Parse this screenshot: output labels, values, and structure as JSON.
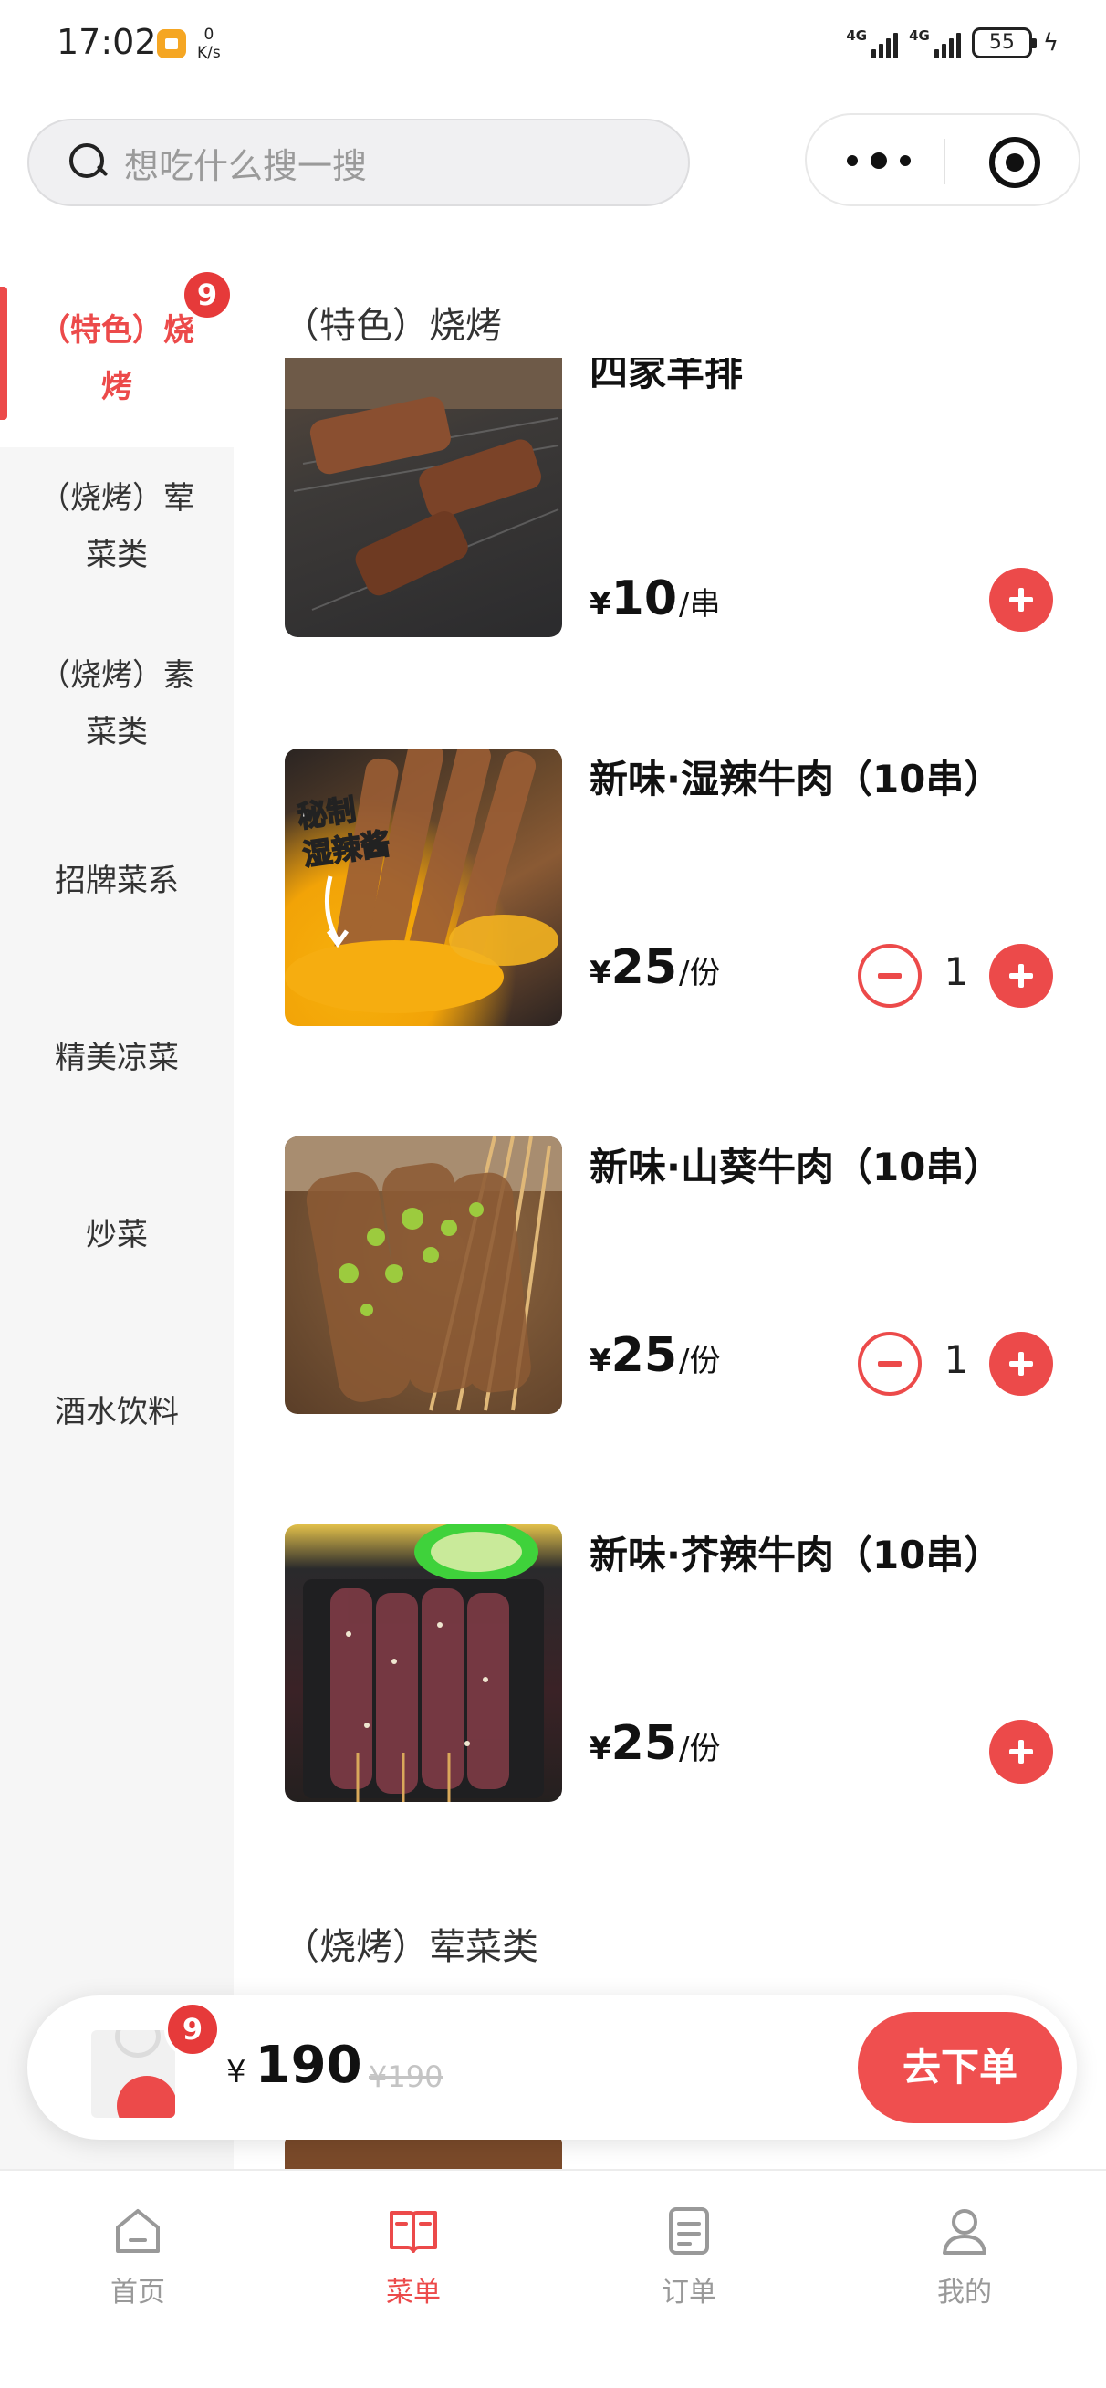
{
  "status": {
    "time": "17:02",
    "speed_value": "0",
    "speed_unit": "K/s",
    "net1": "4G",
    "net2": "4G",
    "battery": "55"
  },
  "search": {
    "placeholder": "想吃什么搜一搜"
  },
  "sidebar": {
    "items": [
      {
        "label": "（特色）烧烤",
        "active": true,
        "badge": "9"
      },
      {
        "label": "（烧烤）荤菜类"
      },
      {
        "label": "（烧烤）素菜类"
      },
      {
        "label": "招牌菜系"
      },
      {
        "label": "精美凉菜"
      },
      {
        "label": "炒菜"
      },
      {
        "label": "酒水饮料"
      }
    ]
  },
  "menu": {
    "section1_title": "（特色）烧烤",
    "section2_title": "（烧烤）荤菜类",
    "products": [
      {
        "name": "四家羊排",
        "yen": "¥",
        "price": "10",
        "unit": "/串"
      },
      {
        "name": "新味·湿辣牛肉（10串）",
        "yen": "¥",
        "price": "25",
        "unit": "/份",
        "qty": "1",
        "sticker": "秘制\n湿辣酱"
      },
      {
        "name": "新味·山葵牛肉（10串）",
        "yen": "¥",
        "price": "25",
        "unit": "/份",
        "qty": "1"
      },
      {
        "name": "新味·芥辣牛肉（10串）",
        "yen": "¥",
        "price": "25",
        "unit": "/份"
      }
    ]
  },
  "cart": {
    "badge": "9",
    "yen": "¥",
    "total": "190",
    "original": "¥190",
    "checkout_label": "去下单"
  },
  "tabs": [
    {
      "label": "首页",
      "icon": "home-icon"
    },
    {
      "label": "菜单",
      "icon": "menu-book-icon",
      "active": true
    },
    {
      "label": "订单",
      "icon": "order-list-icon"
    },
    {
      "label": "我的",
      "icon": "profile-icon"
    }
  ],
  "colors": {
    "accent": "#ec4a4a",
    "badge": "#e63a3a",
    "sidebar_bg": "#f6f6f6"
  }
}
